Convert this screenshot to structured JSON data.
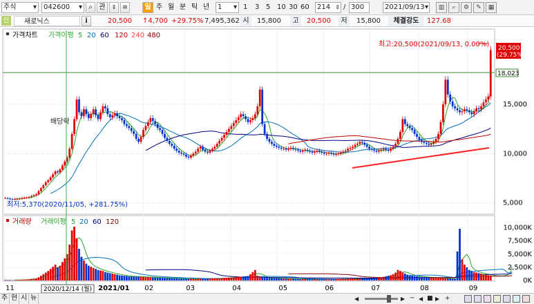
{
  "toolbar": {
    "market_type": "주식",
    "stock_code": "042600",
    "compare_label": "관",
    "period_active": "일",
    "periods": [
      "주",
      "월",
      "분",
      "틱",
      "년"
    ],
    "interval_value": "1",
    "interval_presets": [
      "1",
      "3",
      "5",
      "10",
      "30",
      "60"
    ],
    "display_count": "214",
    "slash": "/",
    "total_count": "300",
    "date": "2021/09/13",
    "icons": [
      "chart-type-icon",
      "find-icon",
      "settings-icon",
      "tools-icon",
      "grid-icon"
    ]
  },
  "quote": {
    "badge": "신",
    "name": "새로닉스",
    "info_label": "i",
    "price": "20,500",
    "change": "↑4,700",
    "change_rate": "+29.75%",
    "volume": "7,495,362",
    "open_label": "시",
    "open": "15,800",
    "high_label": "고",
    "high": "20,500",
    "low_label": "저",
    "low": "15,800",
    "strength_label": "체결강도",
    "strength": "127.68"
  },
  "price_legend": {
    "title": "가격차트",
    "ma_label": "가격이평",
    "periods": [
      "5",
      "20",
      "60",
      "120",
      "240",
      "480"
    ],
    "colors": [
      "#2aa52a",
      "#0070c0",
      "#000080",
      "#c00000",
      "#ff4040",
      "#800000"
    ]
  },
  "volume_legend": {
    "title": "거래량",
    "ma_label": "거래이평",
    "periods": [
      "5",
      "20",
      "60",
      "120"
    ],
    "colors": [
      "#2aa52a",
      "#0070c0",
      "#000080",
      "#800000"
    ]
  },
  "annotations": {
    "high_note": "최고:20,500(2021/09/13, 0.00%)",
    "low_note": "최저:5,370(2020/11/05, +281.75%)",
    "dividend": "배당락",
    "cursor_date": "2020/12/14 (월)",
    "last_price": "20,500",
    "last_rate": "(29.75%)",
    "horizontal_line": "18,023",
    "year_label": "2021/01"
  },
  "chart_data": {
    "type": "candlestick",
    "price_axis": {
      "ticks": [
        "15,000",
        "10,000",
        "5,000"
      ],
      "ylim": [
        4000,
        22500
      ]
    },
    "volume_axis": {
      "ticks": [
        "10,000K",
        "7,500K",
        "5,000K",
        "2,500K",
        "0K"
      ],
      "ylim": [
        0,
        11000000
      ]
    },
    "x_ticks": [
      "11",
      "2021/01",
      "02",
      "03",
      "04",
      "05",
      "06",
      "07",
      "08",
      "09"
    ],
    "closes": [
      5500,
      5450,
      5400,
      5380,
      5390,
      5410,
      5450,
      5500,
      5520,
      5550,
      5600,
      5700,
      5800,
      5900,
      6200,
      6500,
      6800,
      7100,
      7300,
      7600,
      7900,
      8200,
      8100,
      8400,
      8800,
      9200,
      9600,
      10500,
      12000,
      13500,
      15500,
      14200,
      13800,
      14500,
      14000,
      13600,
      14000,
      14500,
      13900,
      13500,
      14200,
      14800,
      14600,
      14000,
      13700,
      13900,
      14100,
      13800,
      13600,
      13400,
      13000,
      12800,
      12600,
      12300,
      12000,
      11500,
      11200,
      11700,
      12400,
      12800,
      13200,
      13600,
      13300,
      13000,
      12600,
      12400,
      12000,
      11600,
      11300,
      11000,
      10800,
      10500,
      10300,
      10100,
      10000,
      9900,
      9700,
      9600,
      9800,
      10000,
      10200,
      10500,
      10700,
      10400,
      10200,
      10100,
      10300,
      10500,
      10700,
      11000,
      11300,
      11600,
      11900,
      12200,
      12500,
      12800,
      13100,
      13400,
      13700,
      14000,
      13800,
      13500,
      13200,
      13400,
      13600,
      14000,
      14800,
      16500,
      13000,
      12000,
      11500,
      11200,
      11000,
      10800,
      10700,
      10600,
      10500,
      10500,
      10400,
      10500,
      10600,
      10500,
      10400,
      10300,
      10200,
      10300,
      10400,
      10300,
      10200,
      10100,
      10200,
      10300,
      10200,
      10100,
      10000,
      10000,
      10100,
      10000,
      9900,
      9950,
      10000,
      10100,
      10200,
      10300,
      10500,
      10600,
      10700,
      10900,
      11000,
      11200,
      11100,
      10900,
      10700,
      10500,
      10400,
      10300,
      10200,
      10300,
      10400,
      10500,
      10400,
      10300,
      10500,
      10700,
      11000,
      11500,
      12200,
      13500,
      13000,
      12800,
      12600,
      12400,
      12000,
      11700,
      11400,
      11200,
      11100,
      11000,
      10900,
      11000,
      11200,
      11500,
      12000,
      13200,
      15000,
      17500,
      16000,
      15300,
      14800,
      14600,
      14400,
      14200,
      14300,
      14500,
      14400,
      14200,
      14000,
      14300,
      14600,
      14500,
      14800,
      15200,
      15500,
      15800,
      20500
    ],
    "volumes": [
      120,
      100,
      90,
      80,
      85,
      90,
      110,
      150,
      180,
      200,
      240,
      300,
      350,
      400,
      600,
      900,
      1200,
      1500,
      1800,
      2200,
      2600,
      3000,
      2500,
      2800,
      3500,
      4200,
      5000,
      6800,
      9500,
      10200,
      8000,
      6000,
      4500,
      3800,
      3200,
      2800,
      2600,
      2400,
      2200,
      2000,
      1900,
      1800,
      1600,
      1500,
      1400,
      1300,
      1200,
      1100,
      1000,
      950,
      900,
      850,
      800,
      780,
      760,
      740,
      720,
      700,
      680,
      660,
      640,
      620,
      600,
      580,
      560,
      540,
      520,
      500,
      480,
      460,
      440,
      420,
      400,
      380,
      360,
      340,
      320,
      300,
      300,
      300,
      310,
      320,
      330,
      340,
      350,
      360,
      370,
      380,
      390,
      400,
      420,
      450,
      480,
      510,
      540,
      570,
      600,
      640,
      680,
      720,
      760,
      800,
      850,
      1200,
      1600,
      2000,
      900,
      700,
      600,
      550,
      500,
      480,
      460,
      440,
      420,
      400,
      380,
      360,
      340,
      320,
      300,
      300,
      290,
      280,
      270,
      260,
      250,
      240,
      230,
      220,
      210,
      200,
      200,
      200,
      210,
      220,
      230,
      240,
      250,
      260,
      270,
      280,
      290,
      300,
      310,
      320,
      330,
      340,
      350,
      360,
      370,
      380,
      390,
      400,
      420,
      450,
      500,
      560,
      620,
      700,
      800,
      900,
      1000,
      1200,
      1500,
      2000,
      1800,
      1500,
      1300,
      1100,
      1000,
      900,
      850,
      800,
      750,
      700,
      650,
      600,
      550,
      500,
      480,
      460,
      440,
      420,
      400,
      380,
      360,
      340,
      320,
      300,
      5500,
      9800,
      4000,
      3000,
      2500,
      2000,
      1800,
      1600,
      1500,
      1400,
      1300,
      1200,
      1100,
      1000,
      950,
      900,
      850,
      800,
      900,
      1000,
      1100,
      1500,
      2000,
      7495
    ]
  }
}
